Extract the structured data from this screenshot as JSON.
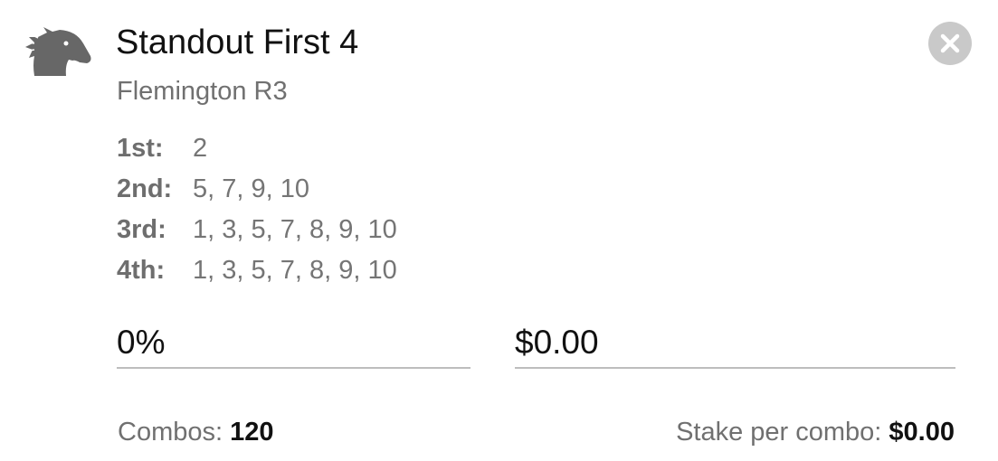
{
  "bet": {
    "icon": "horse-head-icon",
    "title": "Standout First 4",
    "venue": "Flemington R3",
    "close_icon": "close-icon"
  },
  "selections": [
    {
      "label": "1st:",
      "runners": "2"
    },
    {
      "label": "2nd:",
      "runners": "5, 7, 9, 10"
    },
    {
      "label": "3rd:",
      "runners": "1, 3, 5, 7, 8, 9, 10"
    },
    {
      "label": "4th:",
      "runners": "1, 3, 5, 7, 8, 9, 10"
    }
  ],
  "inputs": {
    "percent_value": "0%",
    "amount_value": "$0.00"
  },
  "footer": {
    "combos_label": "Combos:",
    "combos_value": "120",
    "stake_label": "Stake per combo:",
    "stake_value": "$0.00"
  },
  "colors": {
    "icon": "#676767",
    "close_bg": "#c9c9c9",
    "text_primary": "#111111",
    "text_secondary": "#707070",
    "underline": "#bdbdbd"
  }
}
